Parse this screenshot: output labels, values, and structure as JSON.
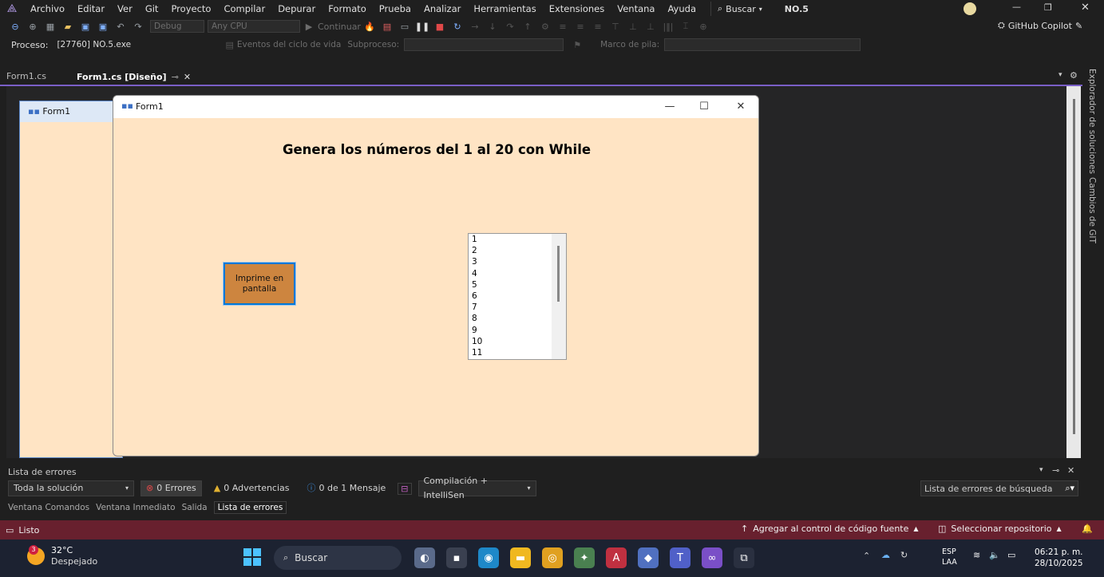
{
  "menu": {
    "items": [
      "Archivo",
      "Editar",
      "Ver",
      "Git",
      "Proyecto",
      "Compilar",
      "Depurar",
      "Formato",
      "Prueba",
      "Analizar",
      "Herramientas",
      "Extensiones",
      "Ventana",
      "Ayuda"
    ],
    "search": "Buscar",
    "solution": "NO.5"
  },
  "toolbar": {
    "config": "Debug",
    "platform": "Any CPU",
    "continue": "Continuar",
    "copilot": "GitHub Copilot"
  },
  "process_bar": {
    "label": "Proceso:",
    "process": "[27760] NO.5.exe",
    "lifecycle": "Eventos del ciclo de vida",
    "thread": "Subproceso:",
    "stack": "Marco de pila:"
  },
  "tabs": [
    {
      "label": "Form1.cs"
    },
    {
      "label": "Form1.cs [Diseño]"
    }
  ],
  "side_panels": {
    "explorer": "Explorador de soluciones",
    "git": "Cambios de GIT"
  },
  "bg_form": {
    "title": "Form1"
  },
  "form": {
    "title": "Form1",
    "heading": "Genera los números del 1 al 20 con While",
    "button": "Imprime en pantalla",
    "list": [
      "1",
      "2",
      "3",
      "4",
      "5",
      "6",
      "7",
      "8",
      "9",
      "10",
      "11"
    ]
  },
  "errors": {
    "title": "Lista de errores",
    "scope": "Toda la solución",
    "errors": "0 Errores",
    "warnings": "0 Advertencias",
    "messages": "0 de 1 Mensaje",
    "build": "Compilación + IntelliSen",
    "search": "Lista de errores de búsqueda",
    "tabs": [
      "Ventana Comandos",
      "Ventana Inmediato",
      "Salida",
      "Lista de errores"
    ]
  },
  "status": {
    "ready": "Listo",
    "add_source": "Agregar al control de código fuente",
    "repo": "Seleccionar repositorio"
  },
  "taskbar": {
    "weather_temp": "32°C",
    "weather_desc": "Despejado",
    "weather_badge": "3",
    "search": "Buscar",
    "lang1": "ESP",
    "lang2": "LAA",
    "time": "06:21 p. m.",
    "date": "28/10/2025"
  },
  "colors": {
    "form_bg": "#ffe4c4",
    "button_bg": "#cd853f",
    "statusbar": "#68202e",
    "accent": "#7a5fc7"
  }
}
